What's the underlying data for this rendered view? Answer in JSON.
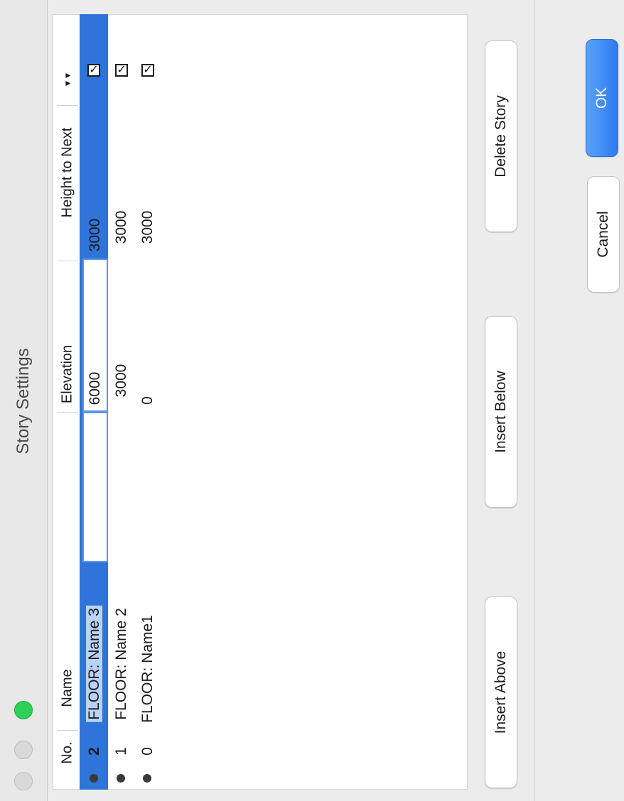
{
  "window": {
    "title": "Story Settings"
  },
  "table": {
    "columns": {
      "no": "No.",
      "name": "Name",
      "elevation": "Elevation",
      "height": "Height to Next"
    },
    "rows": [
      {
        "no": "2",
        "name": "FLOOR: Name 3",
        "elevation": "6000",
        "height": "3000",
        "show": true,
        "selected": true
      },
      {
        "no": "1",
        "name": "FLOOR: Name 2",
        "elevation": "3000",
        "height": "3000",
        "show": true,
        "selected": false
      },
      {
        "no": "0",
        "name": "FLOOR: Name1",
        "elevation": "0",
        "height": "3000",
        "show": true,
        "selected": false
      }
    ]
  },
  "buttons": {
    "insert_above": "Insert Above",
    "insert_below": "Insert Below",
    "delete_story": "Delete Story",
    "cancel": "Cancel",
    "ok": "OK"
  },
  "colors": {
    "selection": "#2f74d8",
    "accent": "#2c7bf0"
  },
  "icons": {
    "checkbox": "✓"
  }
}
